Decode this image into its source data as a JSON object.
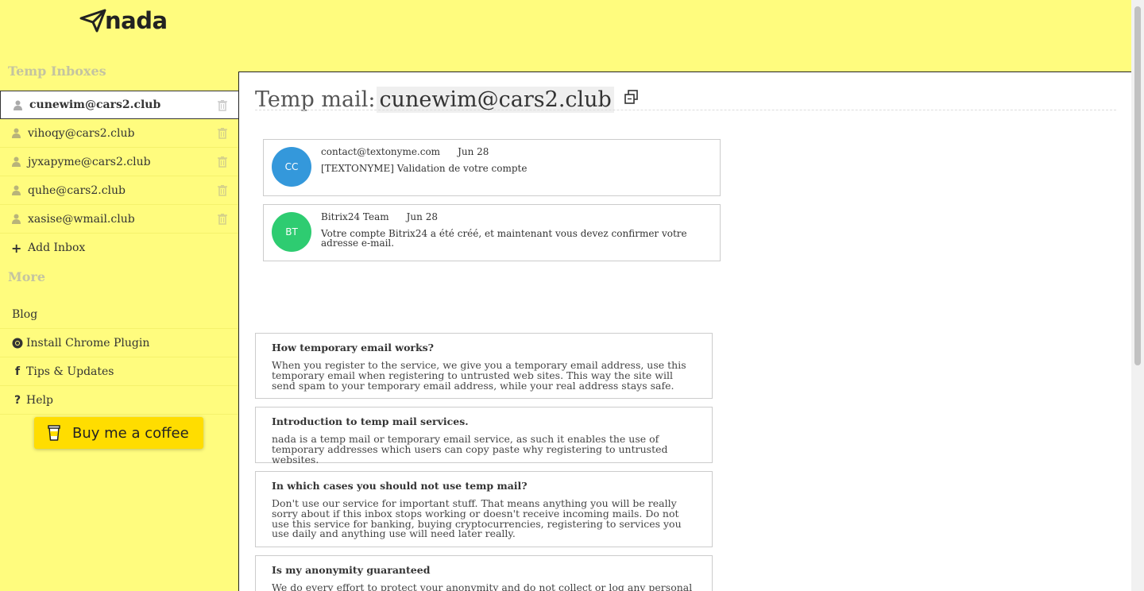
{
  "brand": {
    "name": "nada"
  },
  "sidebar": {
    "inboxes_title": "Temp Inboxes",
    "inboxes": [
      {
        "email": "cunewim@cars2.club",
        "active": true
      },
      {
        "email": "vihoqy@cars2.club",
        "active": false
      },
      {
        "email": "jyxapyme@cars2.club",
        "active": false
      },
      {
        "email": "quhe@cars2.club",
        "active": false
      },
      {
        "email": "xasise@wmail.club",
        "active": false
      }
    ],
    "add_inbox": "Add Inbox",
    "more_title": "More",
    "more_items": [
      {
        "label": "Blog",
        "icon": ""
      },
      {
        "label": "Install Chrome Plugin",
        "icon": "chrome-icon"
      },
      {
        "label": "Tips & Updates",
        "icon": "facebook-icon"
      },
      {
        "label": "Help",
        "icon": "question-icon"
      }
    ],
    "coffee_button": "Buy me a coffee"
  },
  "main": {
    "header_label": "Temp mail:",
    "header_email": "cunewim@cars2.club",
    "mails": [
      {
        "initials": "CC",
        "avatar_color": "#3498db",
        "from": "contact@textonyme.com",
        "date": "Jun 28",
        "subject": "[TEXTONYME] Validation de votre compte"
      },
      {
        "initials": "BT",
        "avatar_color": "#2ecc71",
        "from": "Bitrix24 Team",
        "date": "Jun 28",
        "subject": "Votre compte Bitrix24 a été créé, et maintenant vous devez confirmer votre adresse e-mail."
      }
    ],
    "faq": [
      {
        "q": "How temporary email works?",
        "a": "When you register to the service, we give you a temporary email address, use this temporary email when registering to untrusted web sites. This way the site will send spam to your temporary email address, while your real address stays safe."
      },
      {
        "q": "Introduction to temp mail services.",
        "a": "nada is a temp mail or temporary email service, as such it enables the use of temporary addresses which users can copy paste why registering to untrusted websites."
      },
      {
        "q": "In which cases you should not use temp mail?",
        "a": "Don't use our service for important stuff. That means anything you will be really sorry about if this inbox stops working or doesn't receive incoming mails. Do not use this service for banking, buying cryptocurrencies, registering to services you use daily and anything use will need later really."
      },
      {
        "q": "Is my anonymity guaranteed",
        "a": "We do every effort to protect your anonymity and do not collect or log any personal"
      }
    ]
  },
  "colors": {
    "background": "#fffc7e",
    "coffee": "#ffdd00"
  }
}
